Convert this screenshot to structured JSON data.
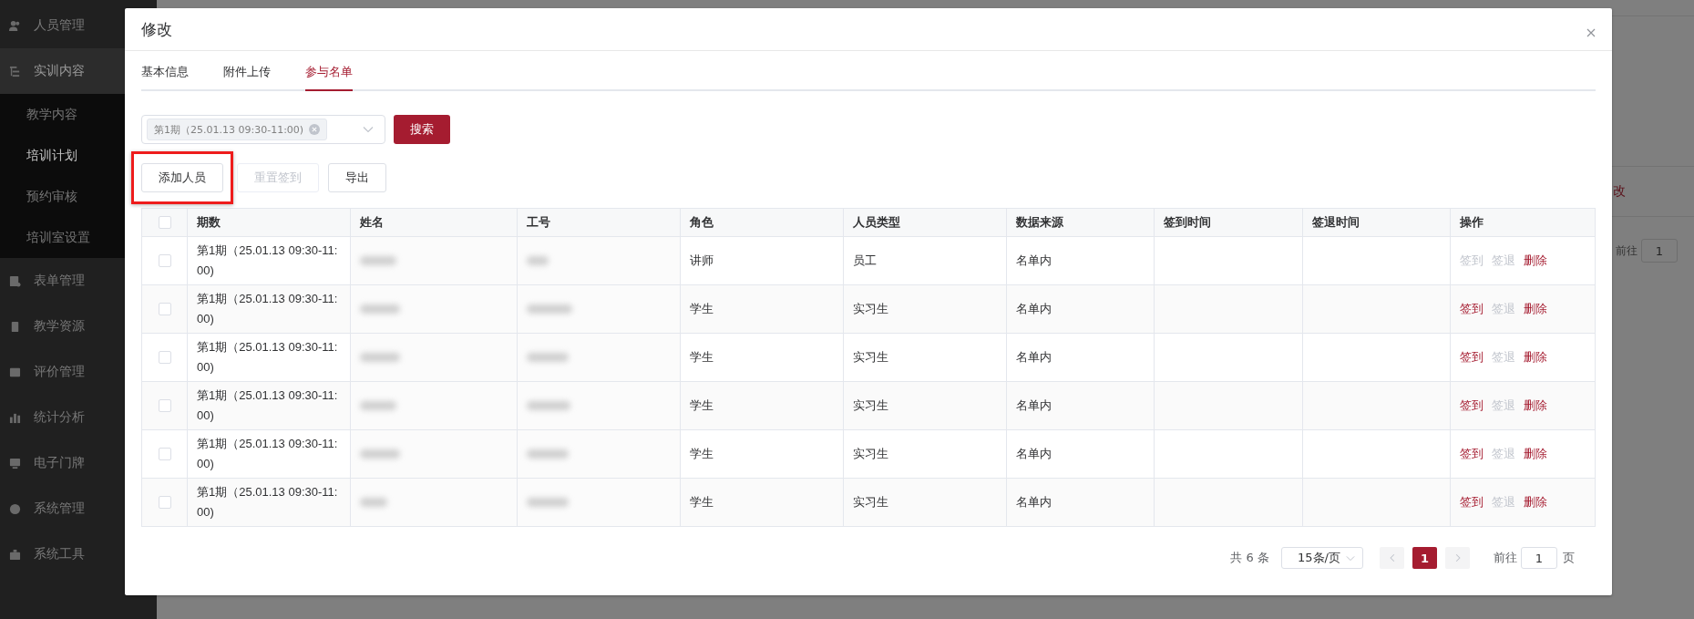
{
  "sidebar": {
    "items": [
      {
        "label": "人员管理"
      },
      {
        "label": "实训内容",
        "expanded": true,
        "children": [
          {
            "label": "教学内容",
            "selected": false
          },
          {
            "label": "培训计划",
            "selected": true
          },
          {
            "label": "预约审核",
            "selected": false
          },
          {
            "label": "培训室设置",
            "selected": false
          }
        ]
      },
      {
        "label": "表单管理"
      },
      {
        "label": "教学资源"
      },
      {
        "label": "评价管理"
      },
      {
        "label": "统计分析"
      },
      {
        "label": "电子门牌"
      },
      {
        "label": "系统管理"
      },
      {
        "label": "系统工具"
      }
    ]
  },
  "background": {
    "tab_fragment": "改",
    "goto_label": "前往",
    "goto_value": "1"
  },
  "dialog": {
    "title": "修改",
    "tabs": [
      {
        "label": "基本信息",
        "selected": false
      },
      {
        "label": "附件上传",
        "selected": false
      },
      {
        "label": "参与名单",
        "selected": true
      }
    ],
    "filter": {
      "tag": "第1期（25.01.13 09:30-11:00)",
      "search_button": "搜索"
    },
    "buttons": [
      {
        "label": "添加人员",
        "disabled": false,
        "highlighted": true
      },
      {
        "label": "重置签到",
        "disabled": true,
        "highlighted": false
      },
      {
        "label": "导出",
        "disabled": false,
        "highlighted": false
      }
    ],
    "table": {
      "all_checked": false,
      "columns": [
        "期数",
        "姓名",
        "工号",
        "角色",
        "人员类型",
        "数据来源",
        "签到时间",
        "签退时间",
        "操作"
      ],
      "rows": [
        {
          "checked": false,
          "period": "第1期（25.01.13 09:30-11:00)",
          "role": "讲师",
          "person_type": "员工",
          "source": "名单内",
          "actions": [
            {
              "label": "签到",
              "disabled": true
            },
            {
              "label": "签退",
              "disabled": true
            },
            {
              "label": "删除",
              "disabled": false
            }
          ]
        },
        {
          "checked": false,
          "period": "第1期（25.01.13 09:30-11:00)",
          "role": "学生",
          "person_type": "实习生",
          "source": "名单内",
          "actions": [
            {
              "label": "签到",
              "disabled": false
            },
            {
              "label": "签退",
              "disabled": true
            },
            {
              "label": "删除",
              "disabled": false
            }
          ]
        },
        {
          "checked": false,
          "period": "第1期（25.01.13 09:30-11:00)",
          "role": "学生",
          "person_type": "实习生",
          "source": "名单内",
          "actions": [
            {
              "label": "签到",
              "disabled": false
            },
            {
              "label": "签退",
              "disabled": true
            },
            {
              "label": "删除",
              "disabled": false
            }
          ]
        },
        {
          "checked": false,
          "period": "第1期（25.01.13 09:30-11:00)",
          "role": "学生",
          "person_type": "实习生",
          "source": "名单内",
          "actions": [
            {
              "label": "签到",
              "disabled": false
            },
            {
              "label": "签退",
              "disabled": true
            },
            {
              "label": "删除",
              "disabled": false
            }
          ]
        },
        {
          "checked": false,
          "period": "第1期（25.01.13 09:30-11:00)",
          "role": "学生",
          "person_type": "实习生",
          "source": "名单内",
          "actions": [
            {
              "label": "签到",
              "disabled": false
            },
            {
              "label": "签退",
              "disabled": true
            },
            {
              "label": "删除",
              "disabled": false
            }
          ]
        },
        {
          "checked": false,
          "period": "第1期（25.01.13 09:30-11:00)",
          "role": "学生",
          "person_type": "实习生",
          "source": "名单内",
          "actions": [
            {
              "label": "签到",
              "disabled": false
            },
            {
              "label": "签退",
              "disabled": true
            },
            {
              "label": "删除",
              "disabled": false
            }
          ]
        }
      ]
    },
    "pagination": {
      "total": "共 6 条",
      "page_size": "15条/页",
      "pages": [
        {
          "label": "1",
          "selected": true
        }
      ],
      "goto_label": "前往",
      "goto_value": "1",
      "page_unit": "页"
    }
  }
}
